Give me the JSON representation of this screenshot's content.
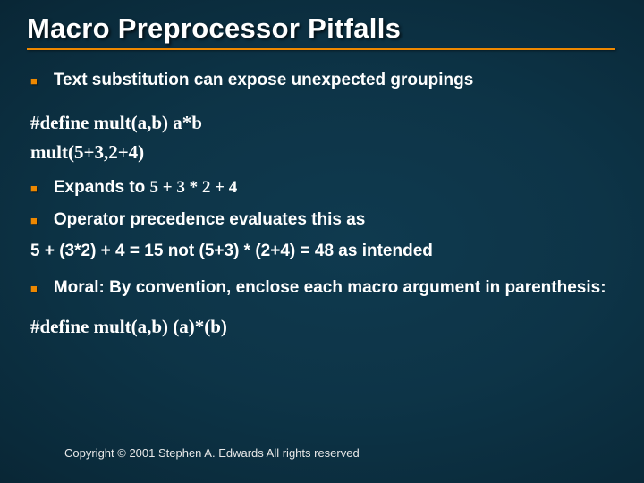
{
  "title": "Macro Preprocessor Pitfalls",
  "bullets": {
    "b1": "Text substitution can expose unexpected groupings",
    "b2_pre": "Expands to ",
    "b2_code": "5 + 3 * 2 + 4",
    "b3": "Operator precedence evaluates this as",
    "b4": "Moral: By convention, enclose each macro argument in parenthesis:"
  },
  "code": {
    "c1": "#define mult(a,b) a*b",
    "c2": "mult(5+3,2+4)",
    "c3": "#define mult(a,b) (a)*(b)"
  },
  "plain": {
    "p1": "5 + (3*2) + 4  = 15 not (5+3) * (2+4) = 48 as intended"
  },
  "footer": "Copyright © 2001 Stephen A. Edwards  All rights reserved"
}
